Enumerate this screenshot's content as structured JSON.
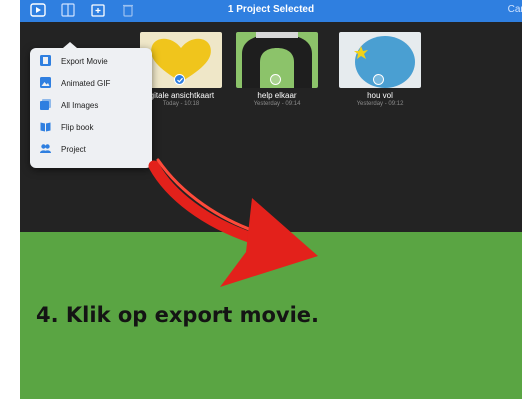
{
  "toolbar": {
    "title": "1 Project Selected",
    "cancel_label": "Can",
    "tools": [
      "play-icon",
      "share-icon",
      "duplicate-icon",
      "trash-icon"
    ]
  },
  "share_menu": {
    "items": [
      {
        "label": "Export Movie",
        "icon": "film-icon"
      },
      {
        "label": "Animated GIF",
        "icon": "gif-image-icon"
      },
      {
        "label": "All Images",
        "icon": "images-icon"
      },
      {
        "label": "Flip book",
        "icon": "book-icon"
      },
      {
        "label": "Project",
        "icon": "people-icon"
      }
    ]
  },
  "projects": [
    {
      "name": "igitale ansichtkaart",
      "date": "Today - 10:18",
      "selected": true
    },
    {
      "name": "help elkaar",
      "date": "Yesterday - 09:14",
      "selected": false
    },
    {
      "name": "hou vol",
      "date": "Yesterday - 09:12",
      "selected": false
    }
  ],
  "instruction": {
    "text": "4. Klik op export movie."
  },
  "colors": {
    "accent": "#2f7fe0",
    "workspace": "#232323",
    "panel": "#5aa543",
    "arrow": "#e3211b"
  }
}
